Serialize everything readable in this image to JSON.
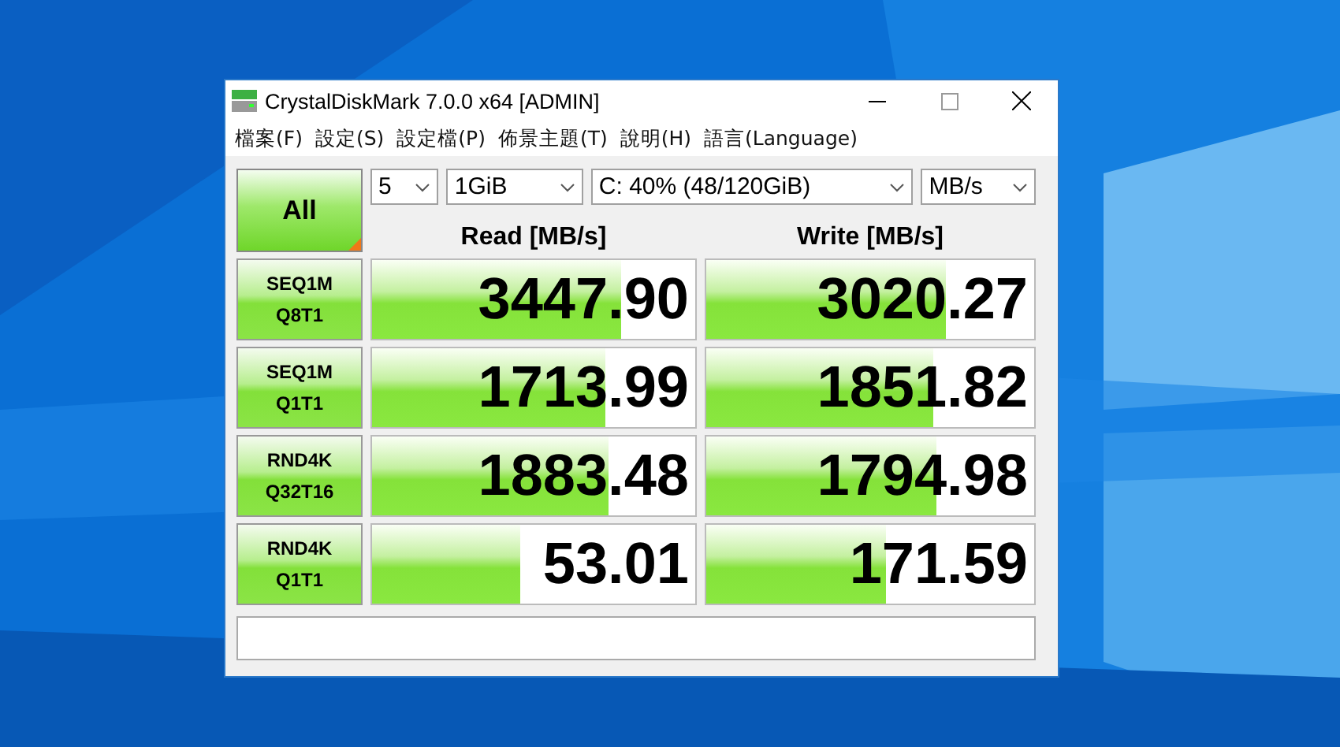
{
  "window": {
    "title": "CrystalDiskMark 7.0.0 x64 [ADMIN]"
  },
  "menu": [
    "檔案(F)",
    "設定(S)",
    "設定檔(P)",
    "佈景主題(T)",
    "說明(H)",
    "語言(Language)"
  ],
  "all_button": {
    "label": "All"
  },
  "selectors": [
    {
      "value": "5"
    },
    {
      "value": "1GiB"
    },
    {
      "value": "C: 40% (48/120GiB)"
    },
    {
      "value": "MB/s"
    }
  ],
  "columns": [
    "Read [MB/s]",
    "Write [MB/s]"
  ],
  "tests": [
    {
      "line1": "SEQ1M",
      "line2": "Q8T1",
      "read": {
        "value": "3447.90",
        "level": 0.77
      },
      "write": {
        "value": "3020.27",
        "level": 0.73
      }
    },
    {
      "line1": "SEQ1M",
      "line2": "Q1T1",
      "read": {
        "value": "1713.99",
        "level": 0.72
      },
      "write": {
        "value": "1851.82",
        "level": 0.69
      }
    },
    {
      "line1": "RND4K",
      "line2": "Q32T16",
      "read": {
        "value": "1883.48",
        "level": 0.73
      },
      "write": {
        "value": "1794.98",
        "level": 0.7
      }
    },
    {
      "line1": "RND4K",
      "line2": "Q1T1",
      "read": {
        "value": "53.01",
        "level": 0.46
      },
      "write": {
        "value": "171.59",
        "level": 0.55
      }
    }
  ]
}
